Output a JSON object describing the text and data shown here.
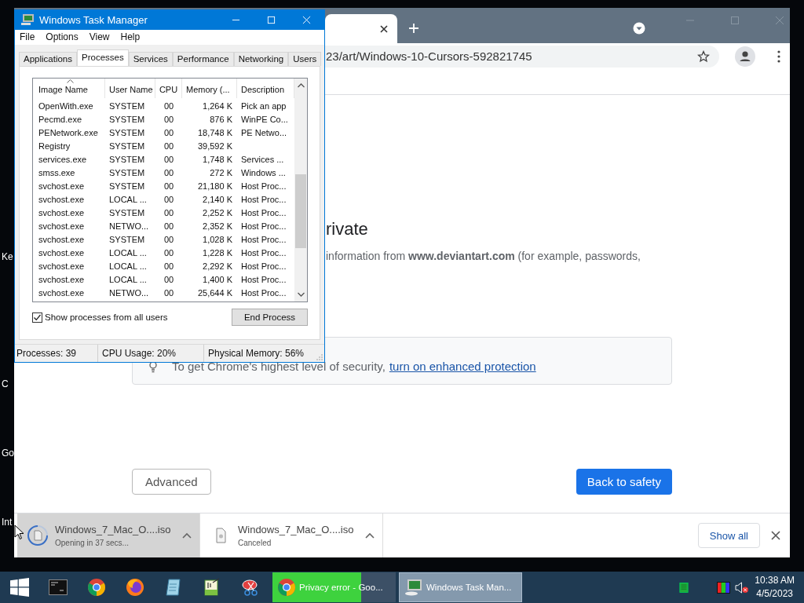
{
  "desktop": {
    "icon_labels": [
      "Ke",
      "C",
      "Go",
      "Int"
    ]
  },
  "browser": {
    "address": "23/art/Windows-10-Cursors-592821745",
    "heading": "rivate",
    "body": "information from **www.deviantart.com** (for example, passwords,",
    "notice": {
      "text": "To get Chrome's highest level of security,",
      "link": "turn on enhanced protection"
    },
    "buttons": [
      {
        "label": "Advanced",
        "kind": "secondary"
      },
      {
        "label": "Back to safety",
        "kind": "primary"
      }
    ],
    "downloads": [
      {
        "name": "Windows_7_Mac_O....iso",
        "status": "Opening in 37 secs...",
        "kind": "opening",
        "selected": true
      },
      {
        "name": "Windows_7_Mac_O....iso",
        "status": "Canceled",
        "kind": "canceled",
        "selected": false
      }
    ],
    "show_all": "Show all"
  },
  "task_manager": {
    "title": "Windows Task Manager",
    "menu": [
      "File",
      "Options",
      "View",
      "Help"
    ],
    "tabs": [
      {
        "label": "Applications",
        "selected": false
      },
      {
        "label": "Processes",
        "selected": true
      },
      {
        "label": "Services",
        "selected": false
      },
      {
        "label": "Performance",
        "selected": false
      },
      {
        "label": "Networking",
        "selected": false
      },
      {
        "label": "Users",
        "selected": false
      }
    ],
    "columns": [
      {
        "label": "Image Name",
        "sorted": true
      },
      {
        "label": "User Name",
        "sorted": false
      },
      {
        "label": "CPU",
        "sorted": false
      },
      {
        "label": "Memory (...",
        "sorted": false
      },
      {
        "label": "Description",
        "sorted": false
      }
    ],
    "rows": [
      {
        "name": "OpenWith.exe",
        "user": "SYSTEM",
        "cpu": "00",
        "memory": "1,264 K",
        "description": "Pick an app"
      },
      {
        "name": "Pecmd.exe",
        "user": "SYSTEM",
        "cpu": "00",
        "memory": "876 K",
        "description": "WinPE Co..."
      },
      {
        "name": "PENetwork.exe",
        "user": "SYSTEM",
        "cpu": "00",
        "memory": "18,748 K",
        "description": "PE Netwo..."
      },
      {
        "name": "Registry",
        "user": "SYSTEM",
        "cpu": "00",
        "memory": "39,592 K"
      },
      {
        "name": "services.exe",
        "user": "SYSTEM",
        "cpu": "00",
        "memory": "1,748 K",
        "description": "Services ..."
      },
      {
        "name": "smss.exe",
        "user": "SYSTEM",
        "cpu": "00",
        "memory": "272 K",
        "description": "Windows ..."
      },
      {
        "name": "svchost.exe",
        "user": "SYSTEM",
        "cpu": "00",
        "memory": "21,180 K",
        "description": "Host Proc..."
      },
      {
        "name": "svchost.exe",
        "user": "LOCAL ...",
        "cpu": "00",
        "memory": "2,140 K",
        "description": "Host Proc..."
      },
      {
        "name": "svchost.exe",
        "user": "SYSTEM",
        "cpu": "00",
        "memory": "2,252 K",
        "description": "Host Proc..."
      },
      {
        "name": "svchost.exe",
        "user": "NETWO...",
        "cpu": "00",
        "memory": "2,352 K",
        "description": "Host Proc..."
      },
      {
        "name": "svchost.exe",
        "user": "SYSTEM",
        "cpu": "00",
        "memory": "1,028 K",
        "description": "Host Proc..."
      },
      {
        "name": "svchost.exe",
        "user": "LOCAL ...",
        "cpu": "00",
        "memory": "1,228 K",
        "description": "Host Proc..."
      },
      {
        "name": "svchost.exe",
        "user": "LOCAL ...",
        "cpu": "00",
        "memory": "2,292 K",
        "description": "Host Proc..."
      },
      {
        "name": "svchost.exe",
        "user": "LOCAL ...",
        "cpu": "00",
        "memory": "1,400 K",
        "description": "Host Proc..."
      },
      {
        "name": "svchost.exe",
        "user": "NETWO...",
        "cpu": "00",
        "memory": "25,644 K",
        "description": "Host Proc..."
      }
    ],
    "show_all_users": {
      "label": "Show processes from all users",
      "checked": true
    },
    "end_process": "End Process",
    "status": [
      "Processes: 39",
      "CPU Usage: 20%",
      "Physical Memory: 56%"
    ]
  },
  "taskbar": {
    "tasks": [
      {
        "label": "Privacy error - Goo...",
        "kind": "browser",
        "selected": false,
        "level": 0.72
      },
      {
        "label": "Windows Task Man...",
        "kind": "taskmgr",
        "selected": true
      }
    ],
    "time": "10:38 AM",
    "date": "4/5/2023"
  }
}
